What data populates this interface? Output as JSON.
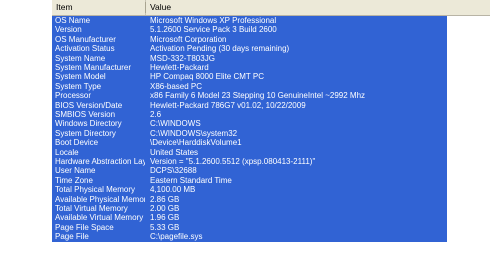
{
  "header": {
    "item": "Item",
    "value": "Value"
  },
  "rows": [
    [
      "OS Name",
      "Microsoft Windows XP Professional"
    ],
    [
      "Version",
      "5.1.2600 Service Pack 3 Build 2600"
    ],
    [
      "OS Manufacturer",
      "Microsoft Corporation"
    ],
    [
      "Activation Status",
      "Activation Pending (30 days remaining)"
    ],
    [
      "System Name",
      "MSD-332-T803JG"
    ],
    [
      "System Manufacturer",
      "Hewlett-Packard"
    ],
    [
      "System Model",
      "HP Compaq 8000 Elite CMT PC"
    ],
    [
      "System Type",
      "X86-based PC"
    ],
    [
      "Processor",
      "x86 Family 6 Model 23 Stepping 10 GenuineIntel ~2992 Mhz"
    ],
    [
      "BIOS Version/Date",
      "Hewlett-Packard 786G7 v01.02, 10/22/2009"
    ],
    [
      "SMBIOS Version",
      "2.6"
    ],
    [
      "Windows Directory",
      "C:\\WINDOWS"
    ],
    [
      "System Directory",
      "C:\\WINDOWS\\system32"
    ],
    [
      "Boot Device",
      "\\Device\\HarddiskVolume1"
    ],
    [
      "Locale",
      "United States"
    ],
    [
      "Hardware Abstraction Layer",
      "Version = \"5.1.2600.5512 (xpsp.080413-2111)\""
    ],
    [
      "User Name",
      "DCPS\\32688"
    ],
    [
      "Time Zone",
      "Eastern Standard Time"
    ],
    [
      "Total Physical Memory",
      "4,100.00 MB"
    ],
    [
      "Available Physical Memory",
      "2.86 GB"
    ],
    [
      "Total Virtual Memory",
      "2.00 GB"
    ],
    [
      "Available Virtual Memory",
      "1.96 GB"
    ],
    [
      "Page File Space",
      "5.33 GB"
    ],
    [
      "Page File",
      "C:\\pagefile.sys"
    ]
  ]
}
